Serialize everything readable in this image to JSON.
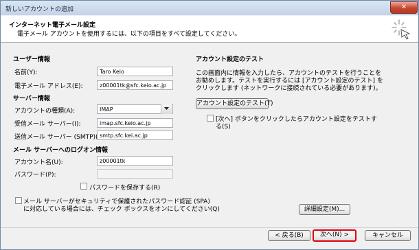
{
  "window": {
    "title": "新しいアカウントの追加",
    "close_glyph": "✕"
  },
  "header": {
    "title": "インターネット電子メール設定",
    "subtitle": "電子メール アカウントを使用するには、以下の項目をすべて設定してください。"
  },
  "user_info": {
    "heading": "ユーザー情報",
    "name_label": "名前(Y):",
    "name_value": "Taro Keio",
    "email_label": "電子メール アドレス(E):",
    "email_value": "z00001tk@sfc.keio.ac.jp"
  },
  "server_info": {
    "heading": "サーバー情報",
    "account_type_label": "アカウントの種類(A):",
    "account_type_value": "IMAP",
    "incoming_label": "受信メール サーバー(I):",
    "incoming_value": "imap.sfc.keio.ac.jp",
    "outgoing_label": "送信メール サーバー (SMTP)(O):",
    "outgoing_value": "smtp.sfc.kei.ac.jp"
  },
  "logon_info": {
    "heading": "メール サーバーへのログオン情報",
    "account_name_label": "アカウント名(U):",
    "account_name_value": "z00001tk",
    "password_label": "パスワード(P):",
    "password_value": "",
    "remember_password_label": "パスワードを保存する(R)",
    "spa_label_line1": "メール サーバーがセキュリティで保護されたパスワード認証 (SPA)",
    "spa_label_line2": "に対応している場合には、チェック ボックスをオンにしてください(Q)"
  },
  "test": {
    "heading": "アカウント設定のテスト",
    "description_line1": "この画面内に情報を入力したら、アカウントのテストを行うことを",
    "description_line2": "お勧めします。テストを実行するには [アカウント設定のテスト] を",
    "description_line3": "クリックします (ネットワークに接続されている必要があります)。",
    "test_button_label": "アカウント設定のテスト(T)",
    "auto_test_label_line1": "[次へ] ボタンをクリックしたらアカウント設定をテストす",
    "auto_test_label_line2": "る(S)"
  },
  "more_settings_label": "詳細設定(M)...",
  "footer": {
    "back_label": "< 戻る(B)",
    "next_label": "次へ(N) >",
    "cancel_label": "キャンセル"
  },
  "colors": {
    "next_highlight": "#e0000f",
    "title_text": "#1b2c44"
  },
  "icons": {
    "banner": "sparkle-icon",
    "dropdown": "chevron-down-icon"
  }
}
